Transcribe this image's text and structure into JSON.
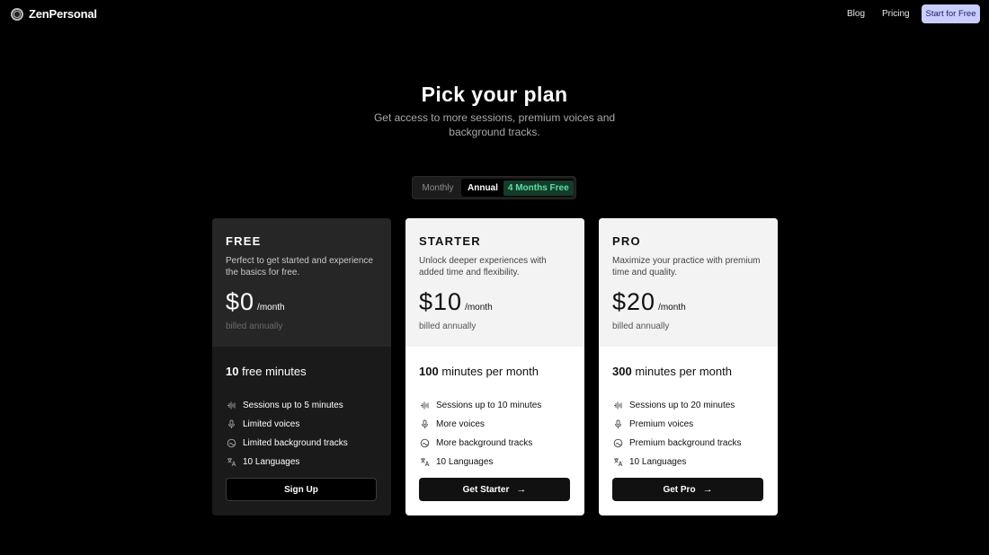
{
  "nav": {
    "brand": "ZenPersonal",
    "links": [
      "Blog",
      "Pricing"
    ],
    "cta": "Start for Free"
  },
  "hero": {
    "title": "Pick your plan",
    "subtitle": "Get access to more sessions, premium voices and background tracks."
  },
  "toggle": {
    "monthly": "Monthly",
    "annual": "Annual",
    "badge": "4 Months Free",
    "selected": "Annual"
  },
  "plans": [
    {
      "name": "FREE",
      "description": "Perfect to get started and experience the basics for free.",
      "price": "$0",
      "period": "/month",
      "billing": "billed annually",
      "minutes_value": "10",
      "minutes_text": " free minutes",
      "features": [
        {
          "icon": "waveform-icon",
          "text": "Sessions up to 5 minutes"
        },
        {
          "icon": "microphone-icon",
          "text": "Limited voices"
        },
        {
          "icon": "music-disc-icon",
          "text": "Limited background tracks"
        },
        {
          "icon": "translate-icon",
          "text": "10 Languages"
        }
      ],
      "cta": "Sign Up"
    },
    {
      "name": "STARTER",
      "description": "Unlock deeper experiences with added time and flexibility.",
      "price": "$10",
      "period": "/month",
      "billing": "billed annually",
      "minutes_value": "100",
      "minutes_text": " minutes per month",
      "features": [
        {
          "icon": "waveform-icon",
          "text": "Sessions up to 10 minutes"
        },
        {
          "icon": "microphone-icon",
          "text": "More voices"
        },
        {
          "icon": "music-disc-icon",
          "text": "More background tracks"
        },
        {
          "icon": "translate-icon",
          "text": "10 Languages"
        }
      ],
      "cta": "Get Starter"
    },
    {
      "name": "PRO",
      "description": "Maximize your practice with premium time and quality.",
      "price": "$20",
      "period": "/month",
      "billing": "billed annually",
      "minutes_value": "300",
      "minutes_text": " minutes per month",
      "features": [
        {
          "icon": "waveform-icon",
          "text": "Sessions up to 20 minutes"
        },
        {
          "icon": "microphone-icon",
          "text": "Premium voices"
        },
        {
          "icon": "music-disc-icon",
          "text": "Premium background tracks"
        },
        {
          "icon": "translate-icon",
          "text": "10 Languages"
        }
      ],
      "cta": "Get Pro"
    }
  ],
  "colors": {
    "background": "#000000",
    "free_card": "#1a1a1a",
    "paid_card": "#ffffff",
    "cta_accent": "#c8cdfd",
    "badge_text": "#58e0a3"
  }
}
